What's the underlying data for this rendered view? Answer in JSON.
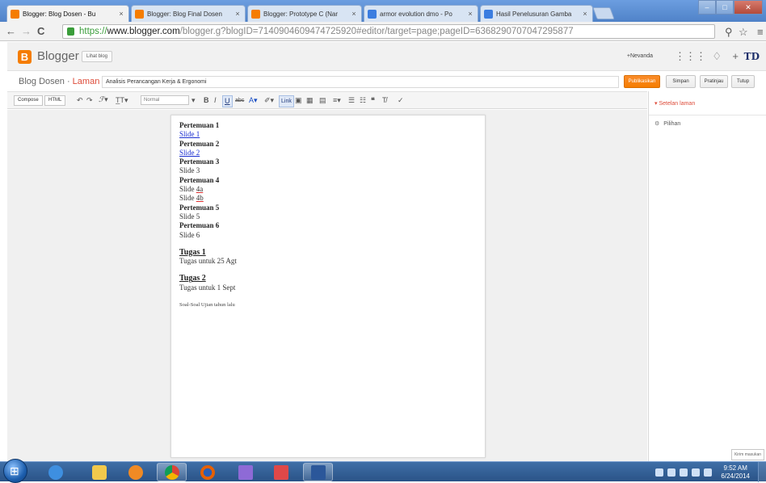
{
  "browser": {
    "tabs": [
      {
        "title": "Blogger: Blog Dosen - Bu",
        "favicon": "blogger",
        "active": true
      },
      {
        "title": "Blogger: Blog Final Dosen",
        "favicon": "blogger",
        "active": false
      },
      {
        "title": "Blogger: Prototype C (Nar",
        "favicon": "blogger",
        "active": false
      },
      {
        "title": "armor evolution dmo - Po",
        "favicon": "google",
        "active": false
      },
      {
        "title": "Hasil Penelusuran Gamba",
        "favicon": "google",
        "active": false
      }
    ],
    "url": {
      "protocol": "https://",
      "host": "www.blogger.com",
      "path": "/blogger.g?blogID=7140904609474725920#editor/target=page;pageID=6368290707047295877"
    }
  },
  "blogger": {
    "brand": "Blogger",
    "view_blog": "Lihat blog",
    "account_name": "+Nevanda",
    "avatar": "TD",
    "crumb_blog": "Blog Dosen",
    "crumb_sep": "·",
    "crumb_section": "Laman",
    "page_title": "Analisis Perancangan Kerja & Ergonomi",
    "buttons": {
      "publish": "Publikasikan",
      "save": "Simpan",
      "preview": "Pratinjau",
      "close": "Tutup"
    },
    "toolbar": {
      "compose": "Compose",
      "html": "HTML",
      "font_size": "Normal",
      "link": "Link"
    }
  },
  "editor": {
    "p1": "Pertemuan 1",
    "s1": "Slide 1",
    "p2": "Pertemuan 2",
    "s2": "Slide 2",
    "p3": "Pertemuan 3",
    "s3": "Slide 3",
    "p4": "Pertemuan 4",
    "s4a_pre": "Slide ",
    "s4a_link": "4a",
    "s4b_pre": "Slide ",
    "s4b_link": "4b",
    "p5": "Pertemuan 5",
    "s5": "Slide 5",
    "p6": "Pertemuan 6",
    "s6": "Slide 6",
    "t1": "Tugas 1",
    "t1_text": "Tugas untuk 25 Agt",
    "t2": "Tugas 2",
    "t2_text": "Tugas untuk 1 Sept",
    "soal": "Soal-Soal Ujian tahun lalu"
  },
  "sidebar": {
    "settings_header": "▾ Setelan laman",
    "options": "Pilihan",
    "send_feedback": "Kirim masukan"
  },
  "taskbar": {
    "time": "9:52 AM",
    "date": "6/24/2014"
  }
}
